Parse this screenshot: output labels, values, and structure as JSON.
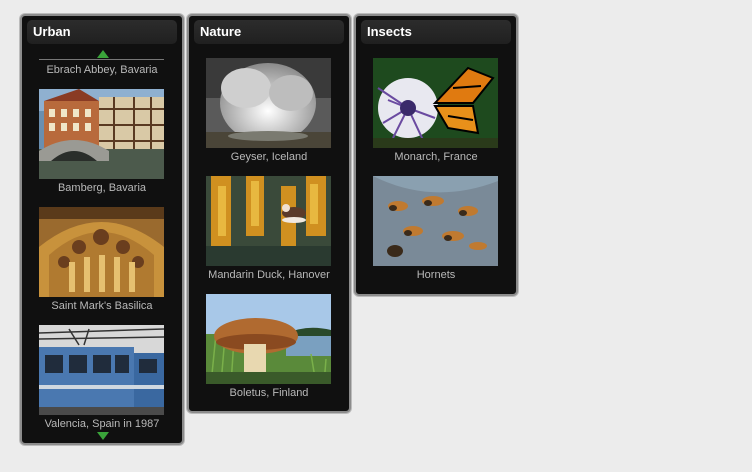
{
  "panels": [
    {
      "title": "Urban",
      "items": [
        {
          "caption": "Ebrach Abbey, Bavaria"
        },
        {
          "caption": "Bamberg, Bavaria"
        },
        {
          "caption": "Saint Mark's Basilica"
        },
        {
          "caption": "Valencia, Spain in 1987"
        }
      ]
    },
    {
      "title": "Nature",
      "items": [
        {
          "caption": "Geyser, Iceland"
        },
        {
          "caption": "Mandarin Duck, Hanover"
        },
        {
          "caption": "Boletus, Finland"
        }
      ]
    },
    {
      "title": "Insects",
      "items": [
        {
          "caption": "Monarch, France"
        },
        {
          "caption": "Hornets"
        }
      ]
    }
  ],
  "colors": {
    "panel_bg": "#101010",
    "caption": "#b9b9b9",
    "arrow": "#3aa43a",
    "page_bg": "#ececec"
  }
}
